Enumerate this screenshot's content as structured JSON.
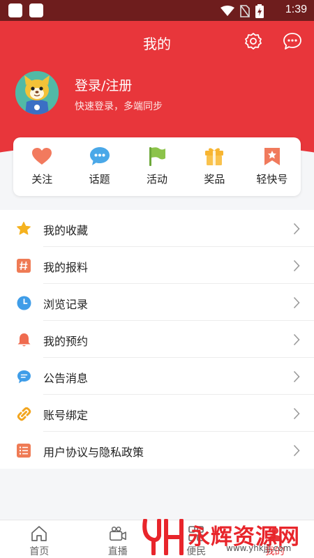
{
  "status_bar": {
    "time": "1:39"
  },
  "header": {
    "title": "我的"
  },
  "user": {
    "login_label": "登录/注册",
    "login_hint": "快速登录，多端同步"
  },
  "quick_actions": [
    {
      "label": "关注",
      "icon": "heart-icon",
      "color": "#f27a5e"
    },
    {
      "label": "话题",
      "icon": "chat-bubble-icon",
      "color": "#4aa8e8"
    },
    {
      "label": "活动",
      "icon": "flag-icon",
      "color": "#8cc34a"
    },
    {
      "label": "奖品",
      "icon": "gift-icon",
      "color": "#f7b531"
    },
    {
      "label": "轻快号",
      "icon": "bookmark-star-icon",
      "color": "#f07a5c"
    }
  ],
  "menu": [
    {
      "label": "我的收藏",
      "icon": "star-icon",
      "color": "#f5b21f"
    },
    {
      "label": "我的报料",
      "icon": "hashtag-icon",
      "color": "#ef7b55"
    },
    {
      "label": " 浏览记录",
      "icon": "clock-icon",
      "color": "#3f9de8"
    },
    {
      "label": "我的预约",
      "icon": "bell-icon",
      "color": "#ef6b4f"
    },
    {
      "label": "公告消息",
      "icon": "message-icon",
      "color": "#3f9de8"
    },
    {
      "label": "账号绑定",
      "icon": "link-icon",
      "color": "#f2a51e"
    },
    {
      "label": "用户协议与隐私政策",
      "icon": "list-icon",
      "color": "#ef7b55"
    }
  ],
  "bottom_nav": [
    {
      "label": "首页",
      "icon": "home-icon"
    },
    {
      "label": "直播",
      "icon": "video-icon"
    },
    {
      "label": "便民",
      "icon": "grid-icon"
    },
    {
      "label": "我的",
      "icon": "user-icon",
      "active": true
    }
  ],
  "watermark": {
    "text": "永辉资源网",
    "url": "www.yhkjjj.com"
  },
  "colors": {
    "primary": "#e8363b",
    "background": "#f5f6f8"
  }
}
